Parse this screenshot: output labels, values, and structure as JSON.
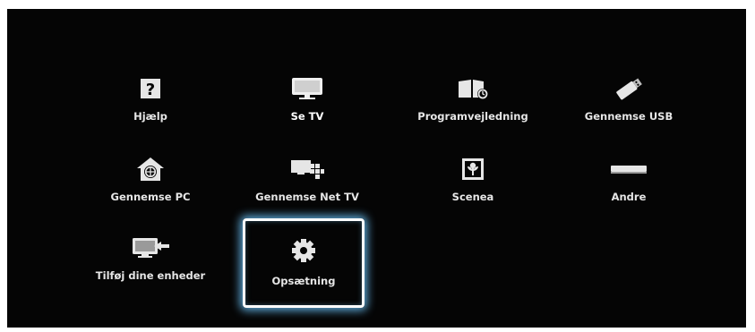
{
  "menu": {
    "items": [
      {
        "label": "Hjælp",
        "icon": "help-icon"
      },
      {
        "label": "Se TV",
        "icon": "tv-icon"
      },
      {
        "label": "Programvejledning",
        "icon": "program-guide-icon"
      },
      {
        "label": "Gennemse USB",
        "icon": "usb-icon"
      },
      {
        "label": "Gennemse PC",
        "icon": "pc-network-icon"
      },
      {
        "label": "Gennemse Net TV",
        "icon": "net-tv-icon"
      },
      {
        "label": "Scenea",
        "icon": "scenea-icon"
      },
      {
        "label": "Andre",
        "icon": "other-device-icon"
      },
      {
        "label": "Tilføj dine enheder",
        "icon": "add-device-icon"
      },
      {
        "label": "Opsætning",
        "icon": "settings-gear-icon"
      }
    ],
    "selected": "Opsætning"
  },
  "colors": {
    "background": "#050505",
    "text": "#e6e6e6",
    "selection_glow": "#6ec8ff"
  }
}
